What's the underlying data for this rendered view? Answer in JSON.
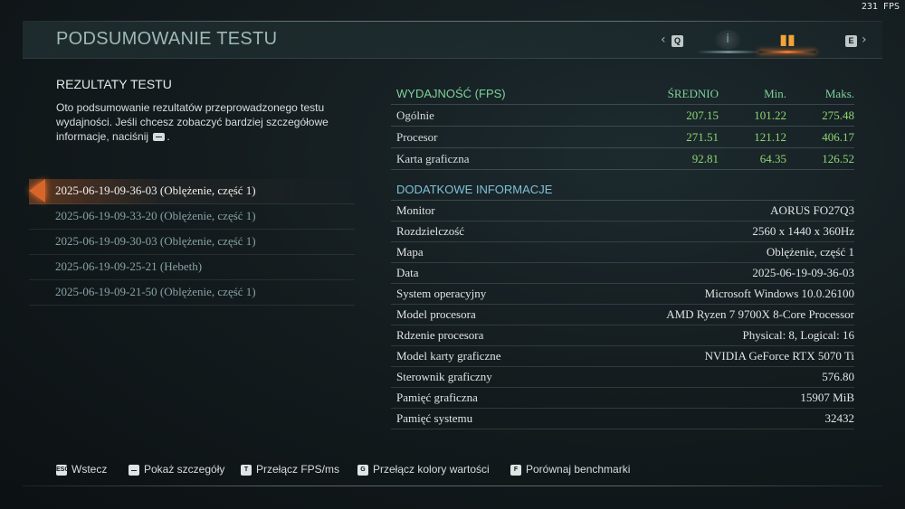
{
  "fps_counter": "231 FPS",
  "title": "PODSUMOWANIE TESTU",
  "header_nav": {
    "prev_key": "Q",
    "next_key": "E"
  },
  "results_section": {
    "title": "REZULTATY TESTU",
    "description_before": "Oto podsumowanie rezultatów przeprowadzonego testu wydajności. Jeśli chcesz zobaczyć bardziej szczegółowe informacje, naciśnij",
    "description_after": "."
  },
  "results": [
    {
      "label": "2025-06-19-09-36-03 (Oblężenie, część 1)",
      "active": true
    },
    {
      "label": "2025-06-19-09-33-20 (Oblężenie, część 1)",
      "active": false
    },
    {
      "label": "2025-06-19-09-30-03 (Oblężenie, część 1)",
      "active": false
    },
    {
      "label": "2025-06-19-09-25-21 (Hebeth)",
      "active": false
    },
    {
      "label": "2025-06-19-09-21-50 (Oblężenie, część 1)",
      "active": false
    }
  ],
  "performance": {
    "header": {
      "label": "WYDAJNOŚĆ (FPS)",
      "avg": "ŚREDNIO",
      "min": "Min.",
      "max": "Maks."
    },
    "rows": [
      {
        "label": "Ogólnie",
        "avg": "207.15",
        "min": "101.22",
        "max": "275.48"
      },
      {
        "label": "Procesor",
        "avg": "271.51",
        "min": "121.12",
        "max": "406.17"
      },
      {
        "label": "Karta graficzna",
        "avg": "92.81",
        "min": "64.35",
        "max": "126.52"
      }
    ]
  },
  "info": {
    "title": "DODATKOWE INFORMACJE",
    "rows": [
      {
        "key": "Monitor",
        "value": "AORUS FO27Q3"
      },
      {
        "key": "Rozdzielczość",
        "value": "2560 x 1440 x 360Hz"
      },
      {
        "key": "Mapa",
        "value": "Oblężenie, część 1"
      },
      {
        "key": "Data",
        "value": "2025-06-19-09-36-03"
      },
      {
        "key": "System operacyjny",
        "value": "Microsoft Windows 10.0.26100"
      },
      {
        "key": "Model procesora",
        "value": "AMD Ryzen 7 9700X 8-Core Processor"
      },
      {
        "key": "Rdzenie procesora",
        "value": "Physical: 8, Logical: 16"
      },
      {
        "key": "Model karty graficzne",
        "value": "NVIDIA GeForce RTX 5070 Ti"
      },
      {
        "key": "Sterownik graficzny",
        "value": "576.80"
      },
      {
        "key": "Pamięć graficzna",
        "value": "15907 MiB"
      },
      {
        "key": "Pamięć systemu",
        "value": "32432"
      }
    ]
  },
  "footer": [
    {
      "key": "ESC",
      "label": "Wstecz"
    },
    {
      "key": "",
      "label": "Pokaż szczegóły"
    },
    {
      "key": "T",
      "label": "Przełącz FPS/ms"
    },
    {
      "key": "G",
      "label": "Przełącz kolory wartości"
    },
    {
      "key": "F",
      "label": "Porównaj benchmarki"
    }
  ],
  "colors": {
    "accent_orange": "#d9652a",
    "value_green": "#8fd672",
    "header_green": "#7fd19a",
    "info_blue": "#7fc0d6",
    "title_teal": "#9fb8b4"
  },
  "icons": {
    "prev_tab": "chevron-left-icon",
    "next_tab": "chevron-right-icon",
    "info_tab": "info-icon",
    "book_tab": "book-icon"
  }
}
